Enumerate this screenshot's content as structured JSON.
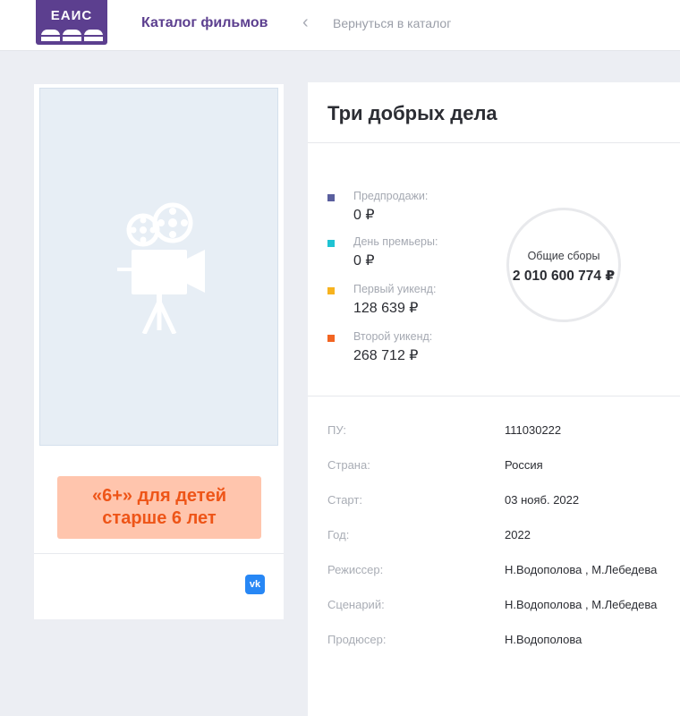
{
  "header": {
    "logo_text": "ЕАИС",
    "catalog_label": "Каталог фильмов",
    "back_label": "Вернуться в каталог"
  },
  "film": {
    "title": "Три добрых дела",
    "age_rating_line1": "«6+» для детей",
    "age_rating_line2": "старше 6 лет",
    "social": "vk"
  },
  "stats": [
    {
      "label": "Предпродажи:",
      "value": "0 ₽",
      "color": "#5a5f9e"
    },
    {
      "label": "День премьеры:",
      "value": "0 ₽",
      "color": "#1fc3d3"
    },
    {
      "label": "Первый уикенд:",
      "value": "128 639 ₽",
      "color": "#f7b31f"
    },
    {
      "label": "Второй уикенд:",
      "value": "268 712 ₽",
      "color": "#f26522"
    }
  ],
  "total": {
    "label": "Общие сборы",
    "value": "2 010 600 774 ₽"
  },
  "info": [
    {
      "key": "ПУ:",
      "value": "111030222"
    },
    {
      "key": "Страна:",
      "value": "Россия"
    },
    {
      "key": "Старт:",
      "value": "03 нояб. 2022"
    },
    {
      "key": "Год:",
      "value": "2022"
    },
    {
      "key": "Режиссер:",
      "value": "Н.Водополова , М.Лебедева"
    },
    {
      "key": "Сценарий:",
      "value": "Н.Водополова , М.Лебедева"
    },
    {
      "key": "Продюсер:",
      "value": "Н.Водополова"
    }
  ],
  "colors": {
    "brand": "#5c3f8f",
    "age_text": "#ee5518",
    "age_bg": "#ffc5ad",
    "vk": "#2787f5"
  },
  "icons": {
    "poster_placeholder": "film-camera-icon",
    "back": "chevron-left-icon"
  }
}
